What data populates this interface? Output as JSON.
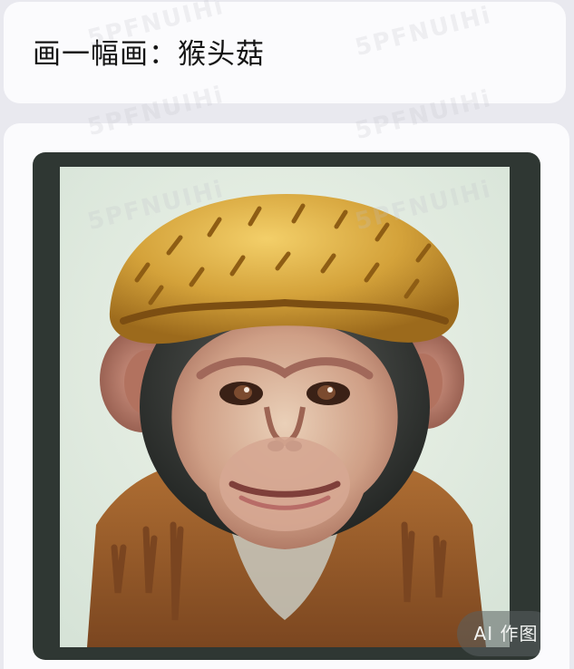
{
  "prompt": {
    "text": "画一幅画：猴头菇"
  },
  "result": {
    "badge_label": "AI 作图"
  },
  "watermark": {
    "text": "5PFNUIHi"
  },
  "colors": {
    "page_bg": "#e9e9ef",
    "card_bg": "#fbfbfd",
    "frame": "#2f3733",
    "canvas_bg": "#e0eadf",
    "mushroom_cap": "#c99428",
    "fur": "#9a5e2b"
  }
}
